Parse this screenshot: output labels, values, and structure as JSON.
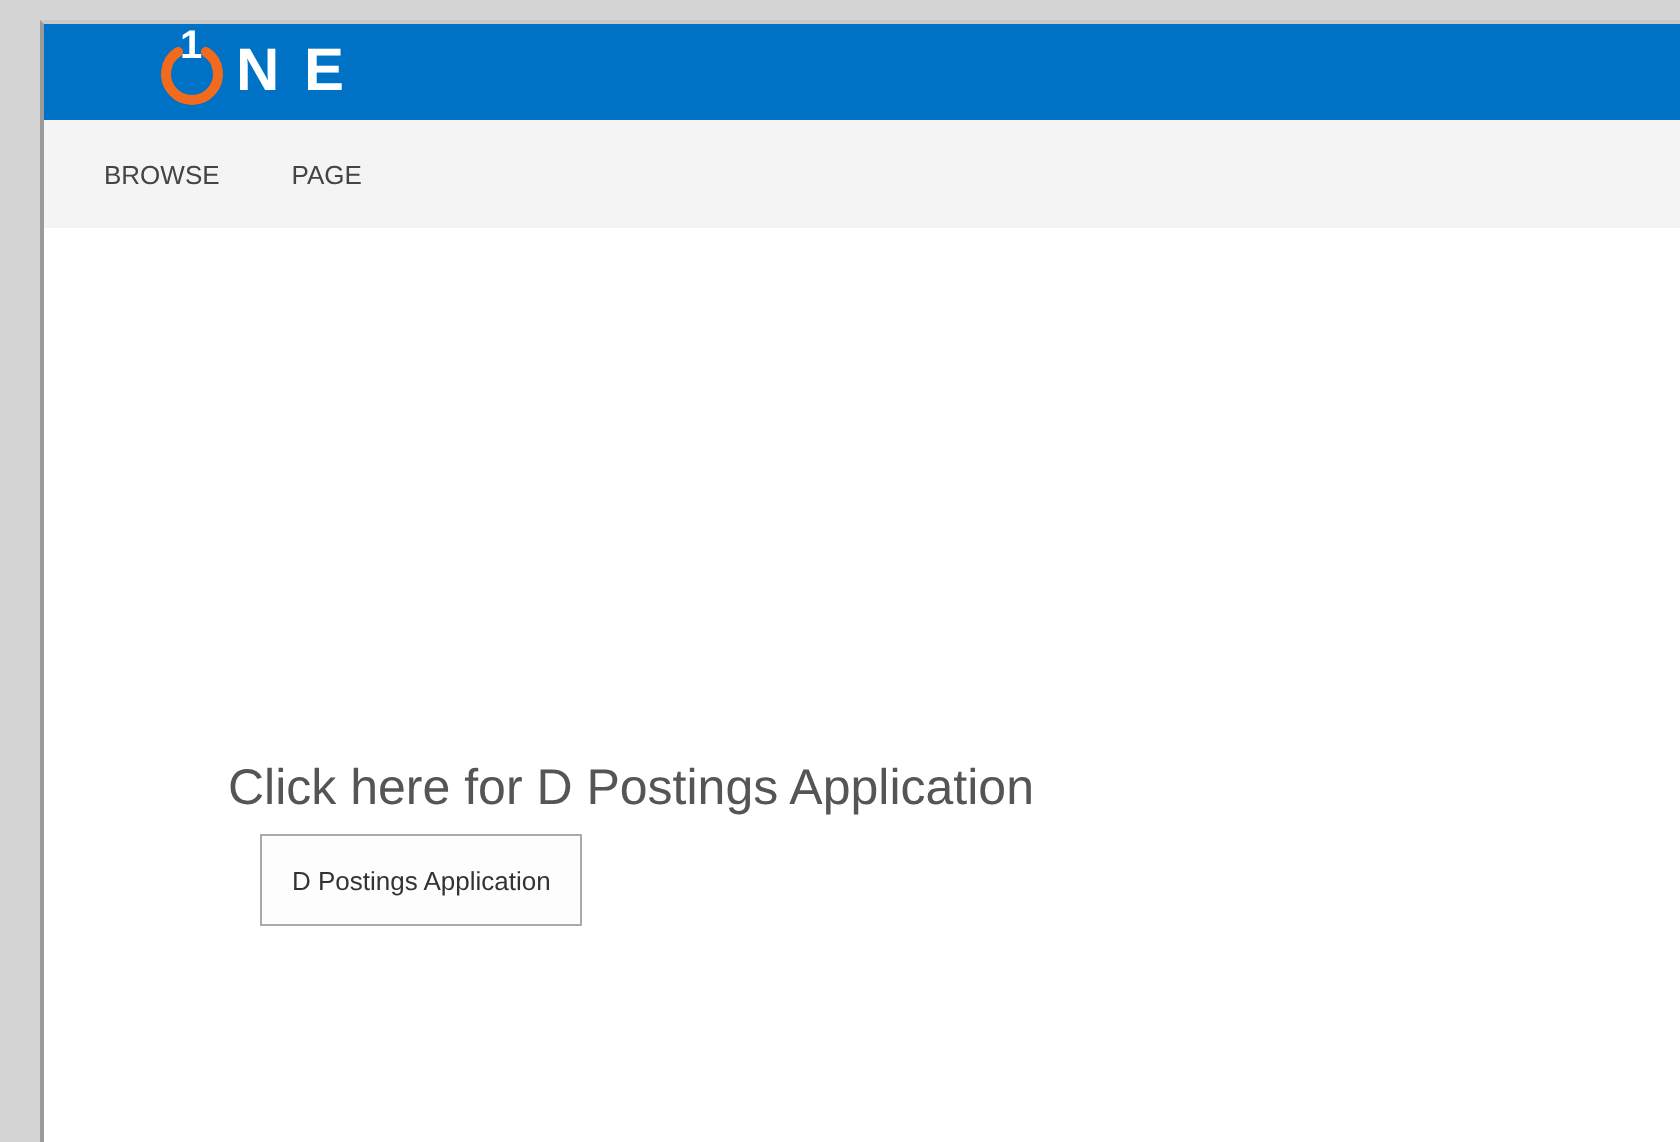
{
  "logo": {
    "digit": "1",
    "letters": "N E"
  },
  "nav": [
    {
      "label": "BROWSE"
    },
    {
      "label": "PAGE"
    }
  ],
  "heading": "Click here for D Postings Application",
  "button": {
    "label": "D Postings Application"
  }
}
